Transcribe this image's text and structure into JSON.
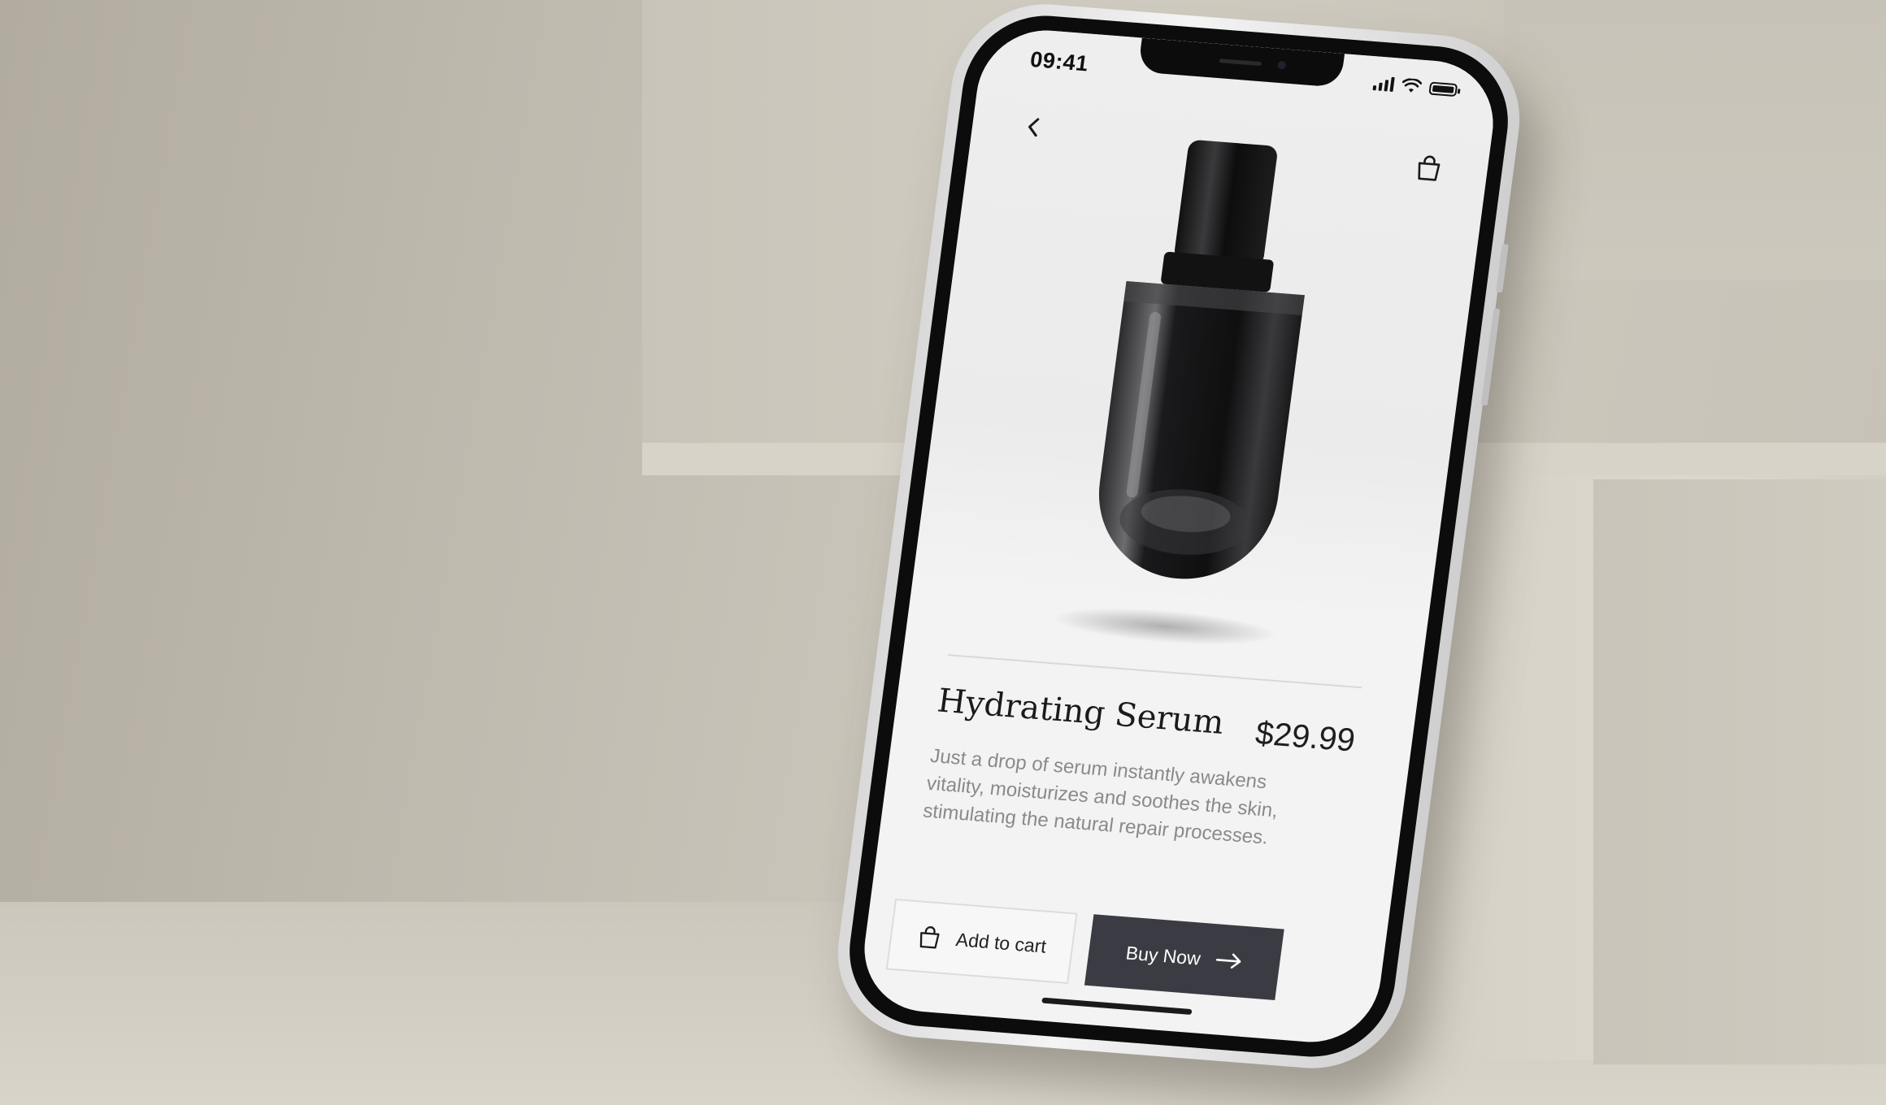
{
  "status_bar": {
    "time": "09:41"
  },
  "product": {
    "title": "Hydrating Serum",
    "price": "$29.99",
    "description": "Just a drop of serum instantly awakens vitality, moisturizes and soothes the skin, stimulating the natural repair processes."
  },
  "actions": {
    "add_to_cart_label": "Add to cart",
    "buy_now_label": "Buy Now"
  },
  "icons": {
    "back": "chevron-left-icon",
    "bag": "shopping-bag-icon",
    "arrow": "arrow-right-icon"
  },
  "colors": {
    "buy_button": "#3b3c43",
    "background": "#bdb8ac"
  }
}
